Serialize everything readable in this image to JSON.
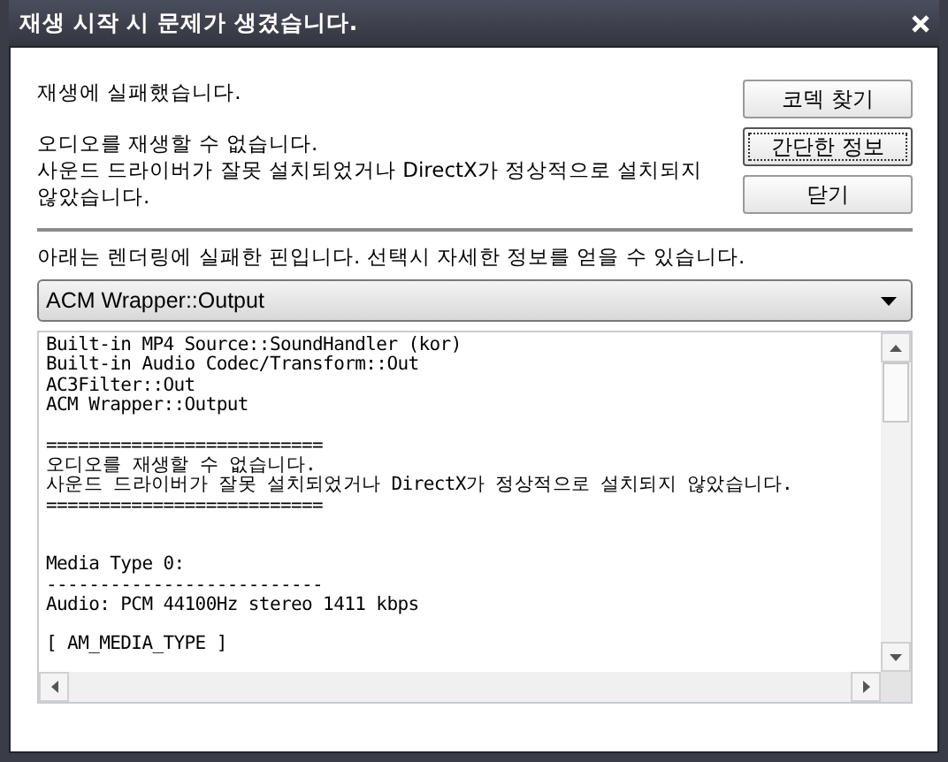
{
  "window": {
    "title": "재생 시작 시 문제가 생겼습니다."
  },
  "messages": [
    "재생에 실패했습니다.",
    "오디오를 재생할 수 없습니다.\n사운드 드라이버가 잘못 설치되었거나 DirectX가 정상적으로 설치되지\n않았습니다."
  ],
  "buttons": [
    {
      "label": "코덱 찾기",
      "focused": false
    },
    {
      "label": "간단한 정보",
      "focused": true
    },
    {
      "label": "닫기",
      "focused": false
    }
  ],
  "pin_label": "아래는 렌더링에 실패한 핀입니다. 선택시 자세한 정보를 얻을 수 있습니다.",
  "pin_dropdown": {
    "value": "ACM Wrapper::Output"
  },
  "log": [
    {
      "kind": "block",
      "lines": [
        "Built-in MP4 Source::SoundHandler (kor)",
        "Built-in Audio Codec/Transform::Out",
        "AC3Filter::Out",
        "ACM Wrapper::Output"
      ]
    },
    {
      "kind": "spaced",
      "lines": [
        "==========================",
        "오디오를 재생할 수 없습니다.",
        "사운드 드라이버가 잘못 설치되었거나 DirectX가 정상적으로 설치되지 않았습니다.",
        "=========================="
      ]
    },
    {
      "kind": "wide_spaced",
      "lines": [
        "Media Type 0:",
        "--------------------------",
        "Audio: PCM 44100Hz stereo 1411 kbps"
      ]
    },
    {
      "kind": "spaced",
      "lines": [
        "[ AM_MEDIA_TYPE ]"
      ]
    }
  ]
}
